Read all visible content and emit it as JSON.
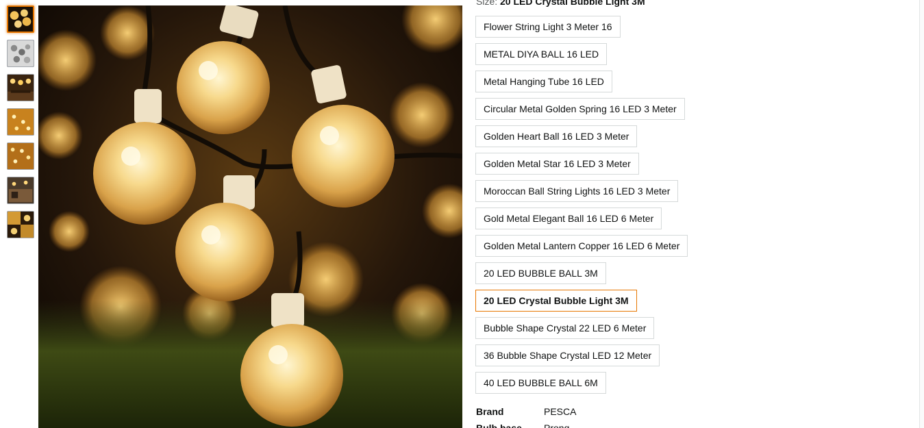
{
  "size": {
    "prefix": "Size: ",
    "selected": "20 LED Crystal Bubble Light 3M"
  },
  "thumbnails": [
    {
      "name": "thumbnail-1"
    },
    {
      "name": "thumbnail-2"
    },
    {
      "name": "thumbnail-3"
    },
    {
      "name": "thumbnail-4"
    },
    {
      "name": "thumbnail-5"
    },
    {
      "name": "thumbnail-6"
    },
    {
      "name": "thumbnail-7"
    }
  ],
  "options": [
    "Flower String Light 3 Meter 16",
    "METAL DIYA BALL 16 LED",
    "Metal Hanging Tube 16 LED",
    "Circular Metal Golden Spring 16 LED 3 Meter",
    "Golden Heart Ball 16 LED 3 Meter",
    "Golden Metal Star 16 LED 3 Meter",
    "Moroccan Ball String Lights 16 LED 3 Meter",
    "Gold Metal Elegant Ball 16 LED 6 Meter",
    "Golden Metal Lantern Copper 16 LED 6 Meter",
    "20 LED BUBBLE BALL 3M",
    "20 LED Crystal Bubble Light 3M",
    "Bubble Shape Crystal 22 LED 6 Meter",
    "36 Bubble Shape Crystal LED 12 Meter",
    "40 LED BUBBLE BALL 6M"
  ],
  "selected_option_index": 10,
  "specs": [
    {
      "key": "Brand",
      "value": "PESCA"
    },
    {
      "key": "Bulb base",
      "value": "Prong"
    }
  ],
  "colors": {
    "selected_border": "#e77600",
    "option_border": "#d5d9d9",
    "text": "#0f1111"
  }
}
